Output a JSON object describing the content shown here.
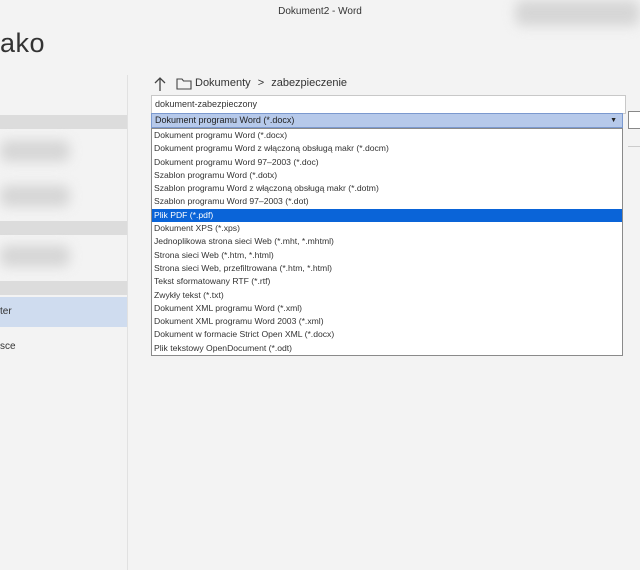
{
  "window": {
    "title": "Dokument2  -  Word"
  },
  "page": {
    "title": "ako"
  },
  "left_nav": {
    "items": [
      {
        "label": "ter",
        "selected": true
      },
      {
        "label": "sce",
        "selected": false
      }
    ]
  },
  "location": {
    "breadcrumb": [
      "Dokumenty",
      ">",
      "zabezpieczenie"
    ]
  },
  "filename": {
    "value": "dokument-zabezpieczony"
  },
  "file_type": {
    "selected": "Dokument programu Word (*.docx)",
    "options": [
      "Dokument programu Word (*.docx)",
      "Dokument programu Word z włączoną obsługą makr (*.docm)",
      "Dokument programu Word 97–2003 (*.doc)",
      "Szablon programu Word (*.dotx)",
      "Szablon programu Word z włączoną obsługą makr (*.dotm)",
      "Szablon programu Word 97–2003 (*.dot)",
      "Plik PDF (*.pdf)",
      "Dokument XPS (*.xps)",
      "Jednoplikowa strona sieci Web (*.mht, *.mhtml)",
      "Strona sieci Web (*.htm, *.html)",
      "Strona sieci Web, przefiltrowana (*.htm, *.html)",
      "Tekst sformatowany RTF (*.rtf)",
      "Zwykły tekst (*.txt)",
      "Dokument XML programu Word (*.xml)",
      "Dokument XML programu Word 2003 (*.xml)",
      "Dokument w formacie Strict Open XML (*.docx)",
      "Plik tekstowy OpenDocument (*.odt)"
    ],
    "highlighted_index": 6
  },
  "colors": {
    "highlight": "#0a64d8",
    "select_bg": "#b6c9ea",
    "nav_selected": "#cfdcef"
  },
  "icons": {
    "up": "arrow-up-icon",
    "folder": "folder-icon",
    "dropdown": "chevron-down-icon"
  }
}
